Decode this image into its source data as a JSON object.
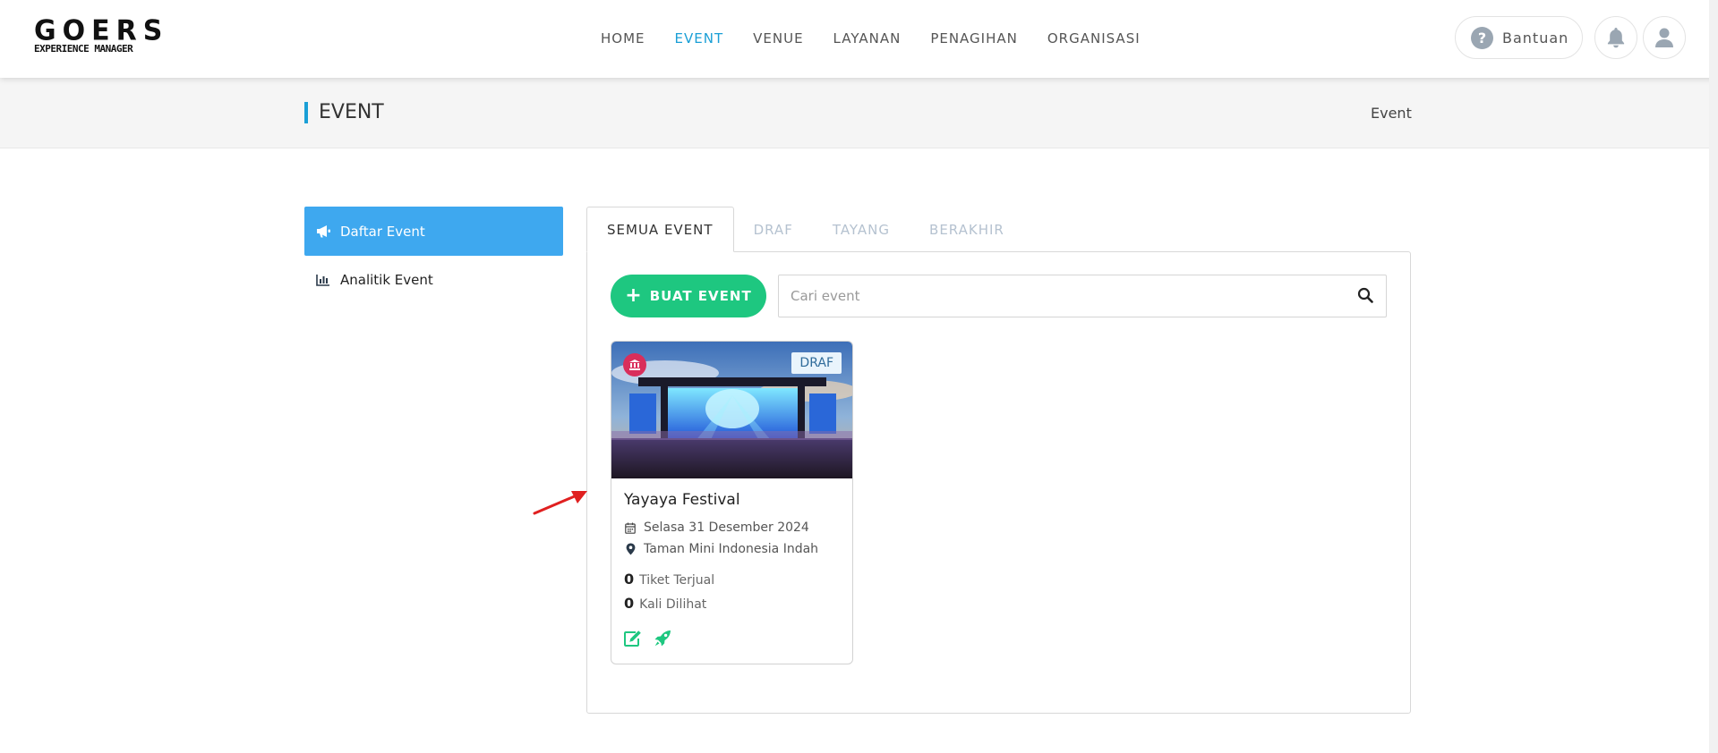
{
  "brand": {
    "name": "GOERS",
    "tagline": "EXPERIENCE MANAGER"
  },
  "nav": {
    "items": [
      {
        "label": "HOME",
        "active": false
      },
      {
        "label": "EVENT",
        "active": true
      },
      {
        "label": "VENUE",
        "active": false
      },
      {
        "label": "LAYANAN",
        "active": false
      },
      {
        "label": "PENAGIHAN",
        "active": false
      },
      {
        "label": "ORGANISASI",
        "active": false
      }
    ],
    "help_label": "Bantuan"
  },
  "page": {
    "title": "EVENT",
    "breadcrumb": "Event"
  },
  "sidebar": {
    "items": [
      {
        "label": "Daftar Event",
        "icon": "megaphone-icon",
        "active": true
      },
      {
        "label": "Analitik Event",
        "icon": "bar-chart-icon",
        "active": false
      }
    ]
  },
  "tabs": [
    {
      "label": "SEMUA EVENT",
      "active": true
    },
    {
      "label": "DRAF",
      "active": false
    },
    {
      "label": "TAYANG",
      "active": false
    },
    {
      "label": "BERAKHIR",
      "active": false
    }
  ],
  "toolbar": {
    "create_label": "BUAT EVENT",
    "search_placeholder": "Cari event",
    "search_value": ""
  },
  "events": [
    {
      "title": "Yayaya Festival",
      "status": "DRAF",
      "date": "Selasa 31 Desember 2024",
      "location": "Taman Mini Indonesia Indah",
      "tickets_sold": "0",
      "tickets_sold_label": "Tiket Terjual",
      "views": "0",
      "views_label": "Kali Dilihat"
    }
  ],
  "colors": {
    "accent": "#1a9fd6",
    "sidebar_active": "#3ea8ef",
    "create_button": "#1ec780",
    "org_badge": "#d92e5b"
  }
}
